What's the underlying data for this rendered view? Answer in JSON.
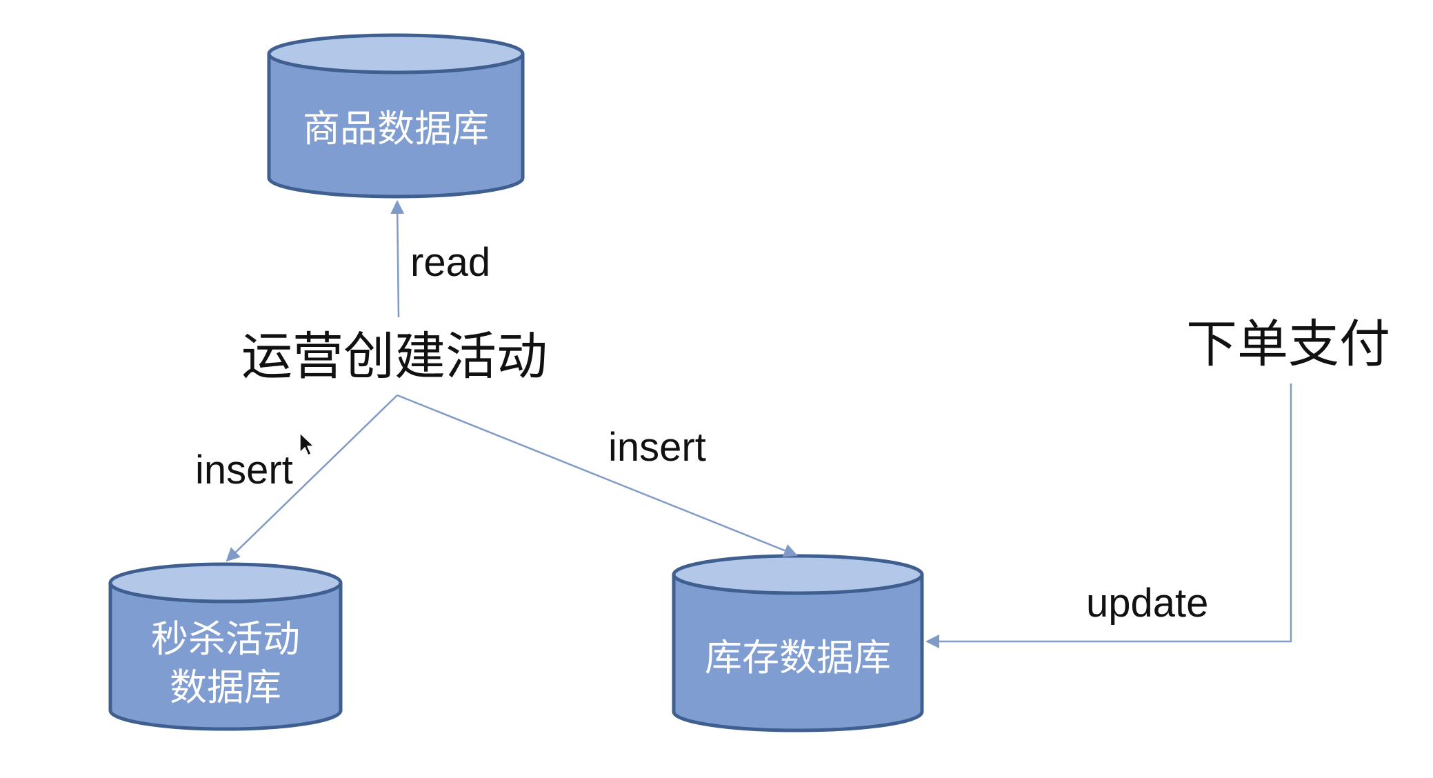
{
  "diagram": {
    "nodes": {
      "product_db": {
        "label": "商品数据库"
      },
      "ops_create": {
        "label": "运营创建活动"
      },
      "order_pay": {
        "label": "下单支付"
      },
      "seckill_db": {
        "label_line1": "秒杀活动",
        "label_line2": "数据库"
      },
      "inventory_db": {
        "label": "库存数据库"
      }
    },
    "edges": {
      "read": "read",
      "insert_left": "insert",
      "insert_right": "insert",
      "update": "update"
    }
  }
}
